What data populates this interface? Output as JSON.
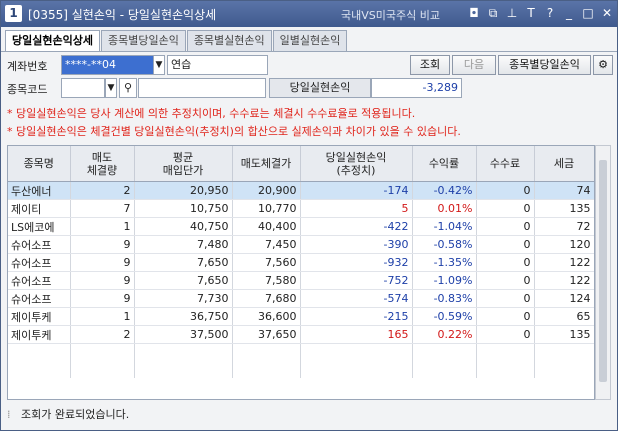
{
  "window": {
    "number": "1",
    "title": "[0355] 실현손익 - 당일실현손익상세",
    "right_text": "국내VS미국주식 비교"
  },
  "titlebar_icons": [
    "restore-window-icon",
    "copy-icon",
    "pin-icon",
    "font-size-icon",
    "help-icon",
    "minimize-icon",
    "maximize-icon",
    "close-icon"
  ],
  "titlebar_icon_glyphs": [
    "◘",
    "⧉",
    "⊥",
    "T",
    "?",
    "_",
    "□",
    "✕"
  ],
  "tabs": [
    {
      "label": "당일실현손익상세",
      "active": true
    },
    {
      "label": "종목별당일손익",
      "active": false
    },
    {
      "label": "종목별실현손익",
      "active": false
    },
    {
      "label": "일별실현손익",
      "active": false
    }
  ],
  "form": {
    "account_label": "계좌번호",
    "account_value": "****-**04",
    "account_name": "연습",
    "stock_code_label": "종목코드",
    "realized_pl_label": "당일실현손익",
    "realized_pl_value": "-3,289"
  },
  "buttons": {
    "query": "조회",
    "next": "다음",
    "by_stock": "종목별당일손익"
  },
  "notes": [
    "* 당일실현손익은 당사 계산에 의한 추정치이며, 수수료는 체결시 수수료율로 적용됩니다.",
    "* 당일실현손익은 체결건별 당일실현손익(추정치)의 합산으로 실제손익과 차이가 있을 수 있습니다."
  ],
  "table": {
    "columns": [
      [
        "종목명"
      ],
      [
        "매도",
        "체결량"
      ],
      [
        "평균",
        "매입단가"
      ],
      [
        "매도체결가"
      ],
      [
        "당일실현손익",
        "(추정치)"
      ],
      [
        "수익률"
      ],
      [
        "수수료"
      ],
      [
        "세금"
      ]
    ],
    "rows": [
      {
        "name": "두산에너",
        "qty": "2",
        "avg": "20,950",
        "sell": "20,900",
        "pl": "-174",
        "rate": "-0.42%",
        "fee": "0",
        "tax": "74",
        "sign": "neg",
        "selected": true
      },
      {
        "name": "제이티",
        "qty": "7",
        "avg": "10,750",
        "sell": "10,770",
        "pl": "5",
        "rate": "0.01%",
        "fee": "0",
        "tax": "135",
        "sign": "pos",
        "selected": false
      },
      {
        "name": "LS에코에",
        "qty": "1",
        "avg": "40,750",
        "sell": "40,400",
        "pl": "-422",
        "rate": "-1.04%",
        "fee": "0",
        "tax": "72",
        "sign": "neg",
        "selected": false
      },
      {
        "name": "슈어소프",
        "qty": "9",
        "avg": "7,480",
        "sell": "7,450",
        "pl": "-390",
        "rate": "-0.58%",
        "fee": "0",
        "tax": "120",
        "sign": "neg",
        "selected": false
      },
      {
        "name": "슈어소프",
        "qty": "9",
        "avg": "7,650",
        "sell": "7,560",
        "pl": "-932",
        "rate": "-1.35%",
        "fee": "0",
        "tax": "122",
        "sign": "neg",
        "selected": false
      },
      {
        "name": "슈어소프",
        "qty": "9",
        "avg": "7,650",
        "sell": "7,580",
        "pl": "-752",
        "rate": "-1.09%",
        "fee": "0",
        "tax": "122",
        "sign": "neg",
        "selected": false
      },
      {
        "name": "슈어소프",
        "qty": "9",
        "avg": "7,730",
        "sell": "7,680",
        "pl": "-574",
        "rate": "-0.83%",
        "fee": "0",
        "tax": "124",
        "sign": "neg",
        "selected": false
      },
      {
        "name": "제이투케",
        "qty": "1",
        "avg": "36,750",
        "sell": "36,600",
        "pl": "-215",
        "rate": "-0.59%",
        "fee": "0",
        "tax": "65",
        "sign": "neg",
        "selected": false
      },
      {
        "name": "제이투케",
        "qty": "2",
        "avg": "37,500",
        "sell": "37,650",
        "pl": "165",
        "rate": "0.22%",
        "fee": "0",
        "tax": "135",
        "sign": "pos",
        "selected": false
      }
    ]
  },
  "status": "조회가 완료되었습니다.",
  "colors": {
    "positive": "#d21818",
    "negative": "#1d3fa8",
    "selected_row": "#cfe3f6",
    "titlebar": "#4a6399"
  }
}
